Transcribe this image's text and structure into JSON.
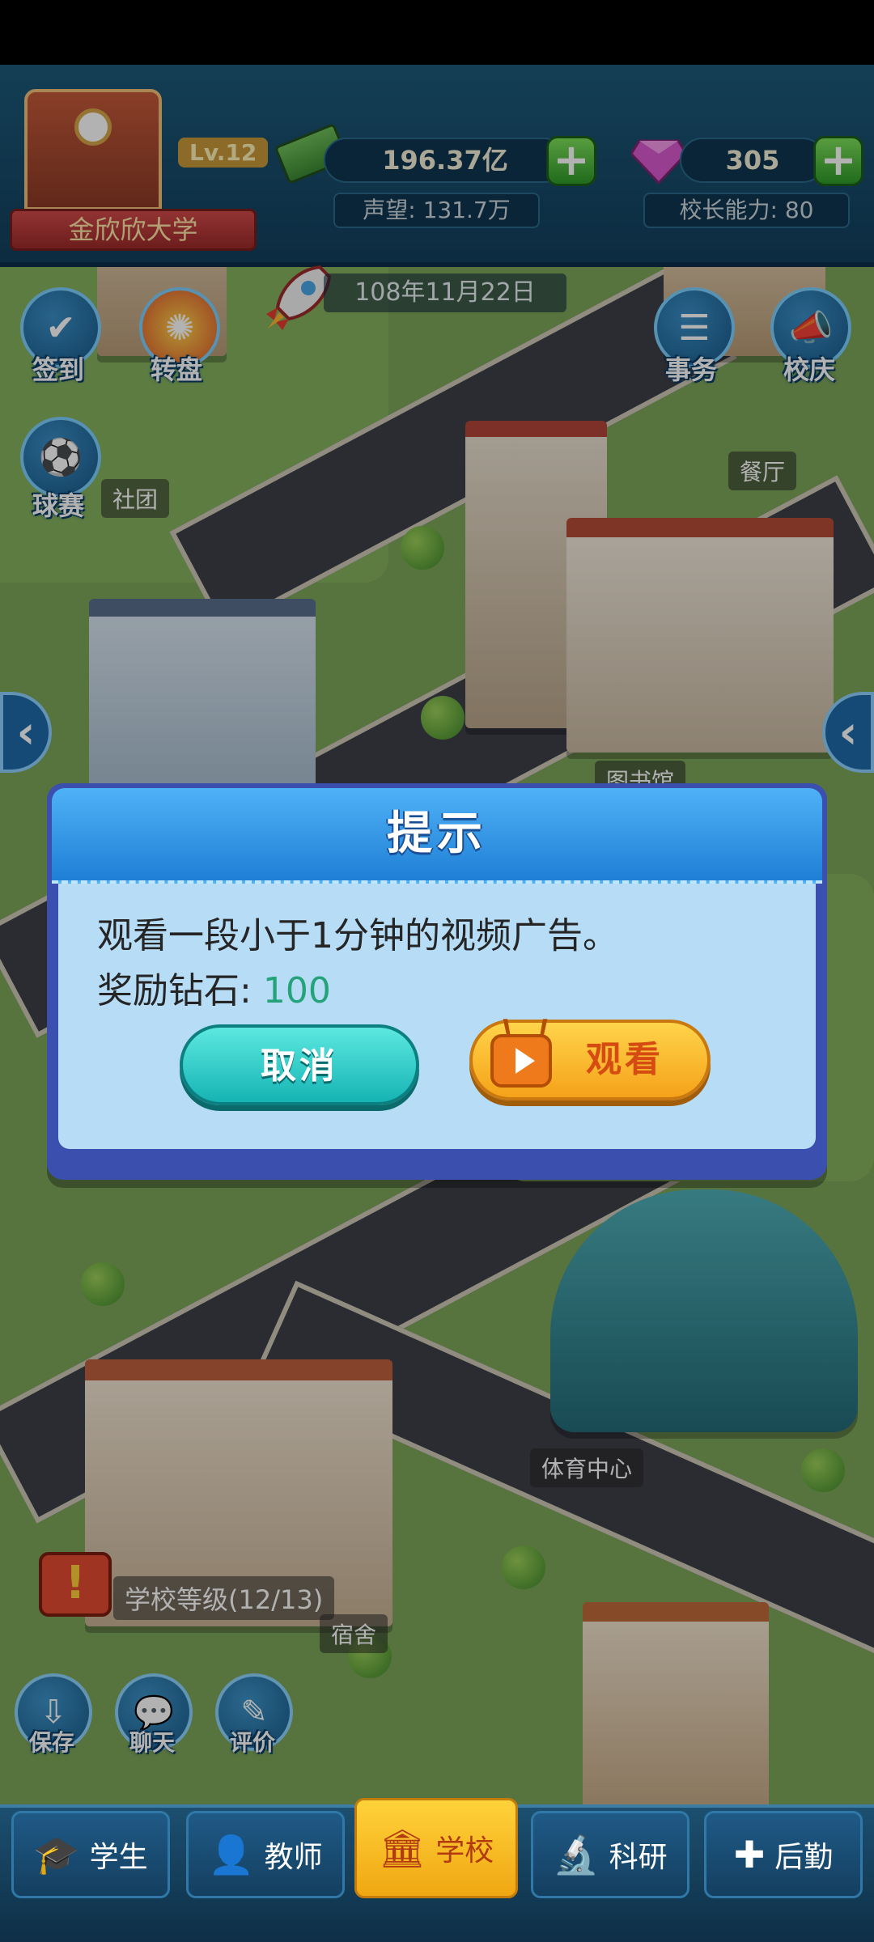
{
  "hud": {
    "school_name": "金欣欣大学",
    "level": "Lv.12",
    "money": "196.37亿",
    "reputation": "声望: 131.7万",
    "diamonds": "305",
    "principal_ability": "校长能力: 80",
    "date": "108年11月22日"
  },
  "side_buttons": {
    "sign_in": "签到",
    "lucky_wheel": "转盘",
    "match": "球赛",
    "affairs": "事务",
    "celebration": "校庆"
  },
  "map_labels": {
    "club": "社团",
    "canteen": "餐厅",
    "library": "图书馆",
    "sports_center": "体育中心",
    "dormitory": "宿舍",
    "school_level": "学校等级(12/13)"
  },
  "dialog": {
    "title": "提示",
    "message": "观看一段小于1分钟的视频广告。",
    "reward_label": "奖励钻石:",
    "reward_value": "100",
    "cancel_label": "取消",
    "watch_label": "观看"
  },
  "mini_buttons": {
    "save": "保存",
    "chat": "聊天",
    "review": "评价"
  },
  "bottom_nav": [
    {
      "label": "学生",
      "icon": "graduation-cap-icon",
      "active": false
    },
    {
      "label": "教师",
      "icon": "teacher-icon",
      "active": false
    },
    {
      "label": "学校",
      "icon": "school-building-icon",
      "active": true
    },
    {
      "label": "科研",
      "icon": "microscope-icon",
      "active": false
    },
    {
      "label": "后勤",
      "icon": "first-aid-kit-icon",
      "active": false
    }
  ],
  "colors": {
    "dialog_header": "#1f7fd6",
    "dialog_body": "#b7dcf6",
    "cancel_button": "#16b4b4",
    "watch_button": "#f5a21a",
    "reward_value": "#24a37a",
    "nav_active": "#ffd23a"
  }
}
